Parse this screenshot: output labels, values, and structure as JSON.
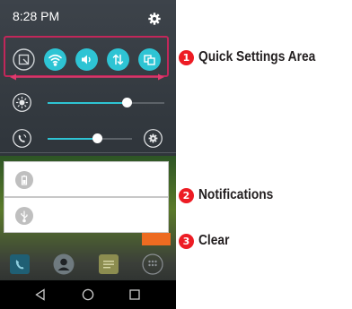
{
  "status_bar": {
    "time": "8:28 PM",
    "settings_icon": "gear-icon"
  },
  "quick_settings": {
    "buttons": [
      {
        "icon": "screen-capture-icon",
        "state": "off"
      },
      {
        "icon": "wifi-icon",
        "state": "on"
      },
      {
        "icon": "sound-icon",
        "state": "on"
      },
      {
        "icon": "data-transfer-icon",
        "state": "on"
      },
      {
        "icon": "multi-window-icon",
        "state": "on"
      }
    ],
    "on_color": "#2ec4d4",
    "highlight_color": "#c1275a"
  },
  "sliders": {
    "brightness": {
      "icon": "brightness-icon",
      "level": 0.68
    },
    "volume": {
      "icon": "ringtone-volume-icon",
      "level": 0.58,
      "settings_icon": "gear-icon"
    }
  },
  "notifications": [
    {
      "icon": "battery-icon"
    },
    {
      "icon": "usb-icon"
    }
  ],
  "clear_button": {
    "color": "#ed6b21"
  },
  "dock": [
    "phone-icon",
    "contacts-icon",
    "messaging-icon",
    "apps-icon"
  ],
  "navigation": [
    "back-icon",
    "home-icon",
    "recents-icon"
  ],
  "callouts": [
    {
      "number": "1",
      "text": "Quick Settings Area"
    },
    {
      "number": "2",
      "text": "Notifications"
    },
    {
      "number": "3",
      "text": "Clear"
    }
  ],
  "callout_color": "#ed1c24"
}
